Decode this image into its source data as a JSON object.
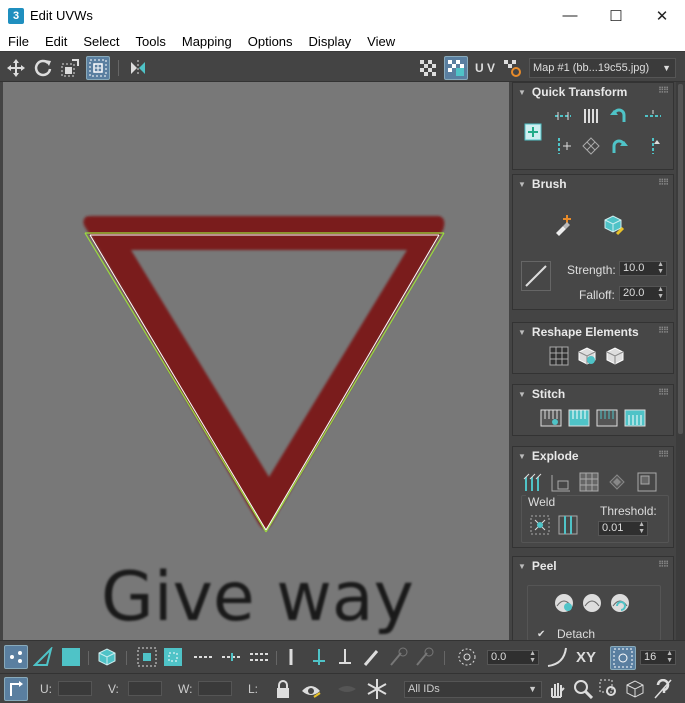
{
  "window": {
    "app_icon": "3",
    "title": "Edit UVWs",
    "minimize": "—",
    "maximize": "☐",
    "close": "✕"
  },
  "menu": [
    "File",
    "Edit",
    "Select",
    "Tools",
    "Mapping",
    "Options",
    "Display",
    "View"
  ],
  "toolbar": {
    "uv_label": "U V",
    "map_select": "Map #1 (bb...19c55.jpg)"
  },
  "viewport": {
    "texture_text": "Give way"
  },
  "rollouts": {
    "quick_transform": {
      "title": "Quick Transform"
    },
    "brush": {
      "title": "Brush",
      "strength_label": "Strength:",
      "strength_value": "10.0",
      "falloff_label": "Falloff:",
      "falloff_value": "20.0"
    },
    "reshape": {
      "title": "Reshape Elements"
    },
    "stitch": {
      "title": "Stitch"
    },
    "explode": {
      "title": "Explode",
      "weld_label": "Weld",
      "threshold_label": "Threshold:",
      "threshold_value": "0.01"
    },
    "peel": {
      "title": "Peel",
      "detach_label": "Detach",
      "detach_checked": true
    }
  },
  "bottom_bar": {
    "spinner_value": "0.0",
    "xy_label": "XY",
    "count_value": "16",
    "u_label": "U:",
    "v_label": "V:",
    "w_label": "W:",
    "l_label": "L:",
    "ids_select": "All IDs"
  },
  "colors": {
    "accent": "#4fc3c7",
    "viewport_bg": "#787878",
    "panel_bg": "#474747",
    "sign_red": "#7a1a1a"
  }
}
